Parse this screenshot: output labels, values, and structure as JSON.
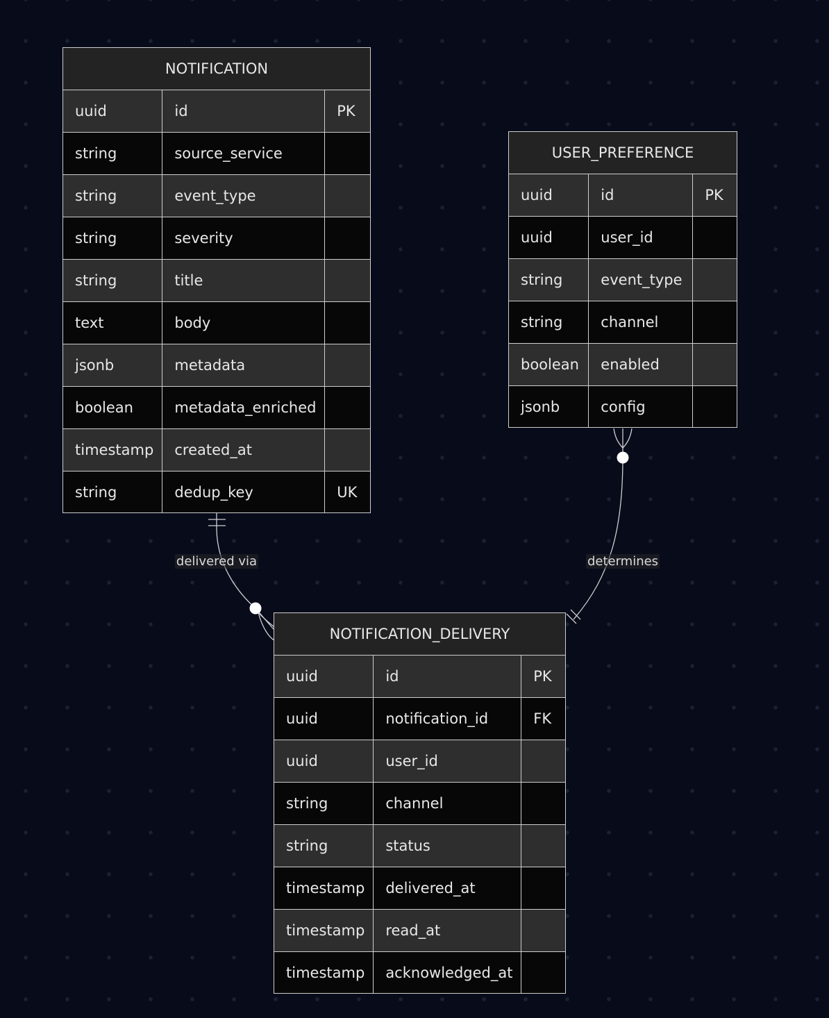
{
  "entities": {
    "notification": {
      "name": "NOTIFICATION",
      "rows": [
        [
          "uuid",
          "id",
          "PK"
        ],
        [
          "string",
          "source_service",
          ""
        ],
        [
          "string",
          "event_type",
          ""
        ],
        [
          "string",
          "severity",
          ""
        ],
        [
          "string",
          "title",
          ""
        ],
        [
          "text",
          "body",
          ""
        ],
        [
          "jsonb",
          "metadata",
          ""
        ],
        [
          "boolean",
          "metadata_enriched",
          ""
        ],
        [
          "timestamp",
          "created_at",
          ""
        ],
        [
          "string",
          "dedup_key",
          "UK"
        ]
      ]
    },
    "user_preference": {
      "name": "USER_PREFERENCE",
      "rows": [
        [
          "uuid",
          "id",
          "PK"
        ],
        [
          "uuid",
          "user_id",
          ""
        ],
        [
          "string",
          "event_type",
          ""
        ],
        [
          "string",
          "channel",
          ""
        ],
        [
          "boolean",
          "enabled",
          ""
        ],
        [
          "jsonb",
          "config",
          ""
        ]
      ]
    },
    "notification_delivery": {
      "name": "NOTIFICATION_DELIVERY",
      "rows": [
        [
          "uuid",
          "id",
          "PK"
        ],
        [
          "uuid",
          "notification_id",
          "FK"
        ],
        [
          "uuid",
          "user_id",
          ""
        ],
        [
          "string",
          "channel",
          ""
        ],
        [
          "string",
          "status",
          ""
        ],
        [
          "timestamp",
          "delivered_at",
          ""
        ],
        [
          "timestamp",
          "read_at",
          ""
        ],
        [
          "timestamp",
          "acknowledged_at",
          ""
        ]
      ]
    }
  },
  "relationships": {
    "delivered_via": "delivered via",
    "determines": "determines"
  },
  "colors": {
    "background": "#070b1a",
    "line": "#cfcfcf",
    "row_light": "#2e2e2e",
    "row_dark": "#070707",
    "header": "#232323"
  }
}
